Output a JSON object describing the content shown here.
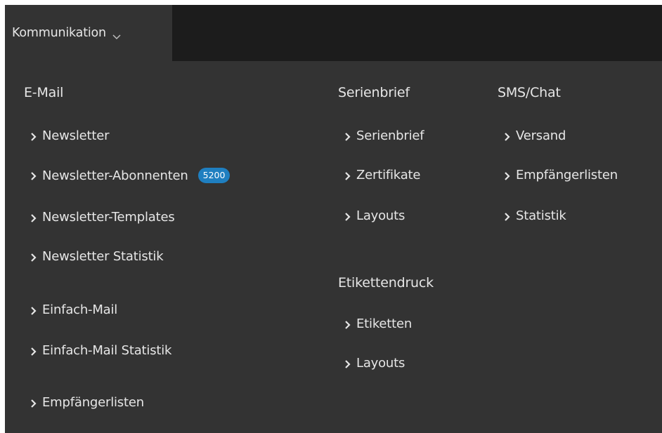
{
  "topbar": {
    "menu_label": "Kommunikation",
    "menu_icon": "chevron-down-icon"
  },
  "colors": {
    "background": "#333333",
    "topbar": "#1c1c1c",
    "text": "#e6e6e6",
    "badge": "#1f7fc0"
  },
  "email": {
    "heading": "E-Mail",
    "items": [
      {
        "label": "Newsletter"
      },
      {
        "label": "Newsletter-Abonnenten",
        "badge": "5200"
      },
      {
        "label": "Newsletter-Templates"
      },
      {
        "label": "Newsletter Statistik"
      },
      {
        "label": "Einfach-Mail"
      },
      {
        "label": "Einfach-Mail Statistik"
      },
      {
        "label": "Empfängerlisten"
      }
    ]
  },
  "serienbrief": {
    "heading": "Serienbrief",
    "items": [
      {
        "label": "Serienbrief"
      },
      {
        "label": "Zertifikate"
      },
      {
        "label": "Layouts"
      }
    ]
  },
  "etikettendruck": {
    "heading": "Etikettendruck",
    "items": [
      {
        "label": "Etiketten"
      },
      {
        "label": "Layouts"
      }
    ]
  },
  "sms_chat": {
    "heading": "SMS/Chat",
    "items": [
      {
        "label": "Versand"
      },
      {
        "label": "Empfängerlisten"
      },
      {
        "label": "Statistik"
      }
    ]
  }
}
